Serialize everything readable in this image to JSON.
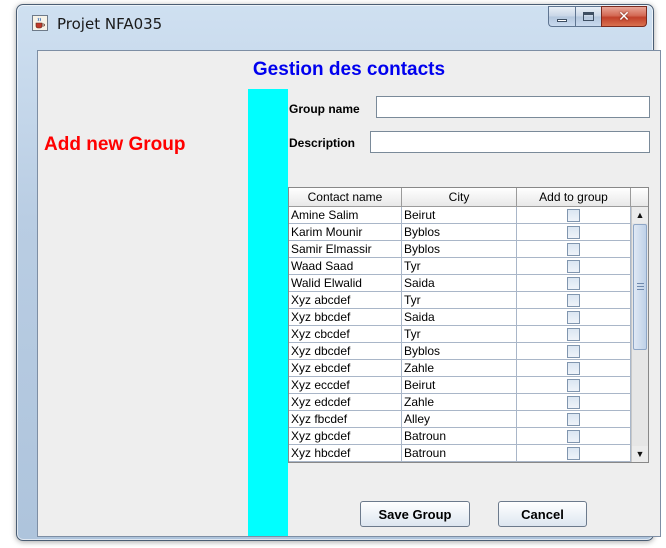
{
  "window": {
    "title": "Projet NFA035"
  },
  "heading": "Gestion des contacts",
  "left_title": "Add new Group",
  "form": {
    "group_name_label": "Group name",
    "group_name_value": "",
    "description_label": "Description",
    "description_value": ""
  },
  "table": {
    "columns": [
      "Contact name",
      "City",
      "Add to group"
    ],
    "rows": [
      {
        "name": "Amine Salim",
        "city": "Beirut",
        "checked": false
      },
      {
        "name": "Karim Mounir",
        "city": "Byblos",
        "checked": false
      },
      {
        "name": "Samir Elmassir",
        "city": "Byblos",
        "checked": false
      },
      {
        "name": "Waad Saad",
        "city": "Tyr",
        "checked": false
      },
      {
        "name": "Walid Elwalid",
        "city": "Saida",
        "checked": false
      },
      {
        "name": "Xyz abcdef",
        "city": "Tyr",
        "checked": false
      },
      {
        "name": "Xyz bbcdef",
        "city": "Saida",
        "checked": false
      },
      {
        "name": "Xyz cbcdef",
        "city": "Tyr",
        "checked": false
      },
      {
        "name": "Xyz dbcdef",
        "city": "Byblos",
        "checked": false
      },
      {
        "name": "Xyz ebcdef",
        "city": "Zahle",
        "checked": false
      },
      {
        "name": "Xyz eccdef",
        "city": "Beirut",
        "checked": false
      },
      {
        "name": "Xyz edcdef",
        "city": "Zahle",
        "checked": false
      },
      {
        "name": "Xyz fbcdef",
        "city": "Alley",
        "checked": false
      },
      {
        "name": "Xyz gbcdef",
        "city": "Batroun",
        "checked": false
      },
      {
        "name": "Xyz hbcdef",
        "city": "Batroun",
        "checked": false
      }
    ]
  },
  "buttons": {
    "save": "Save Group",
    "cancel": "Cancel"
  },
  "colors": {
    "heading": "#0000ee",
    "left_title": "#ff0000",
    "side_bar": "#00ffff"
  },
  "icons": {
    "app": "java-cup-icon",
    "minimize": "minimize-icon",
    "maximize": "maximize-icon",
    "close": "close-icon"
  }
}
